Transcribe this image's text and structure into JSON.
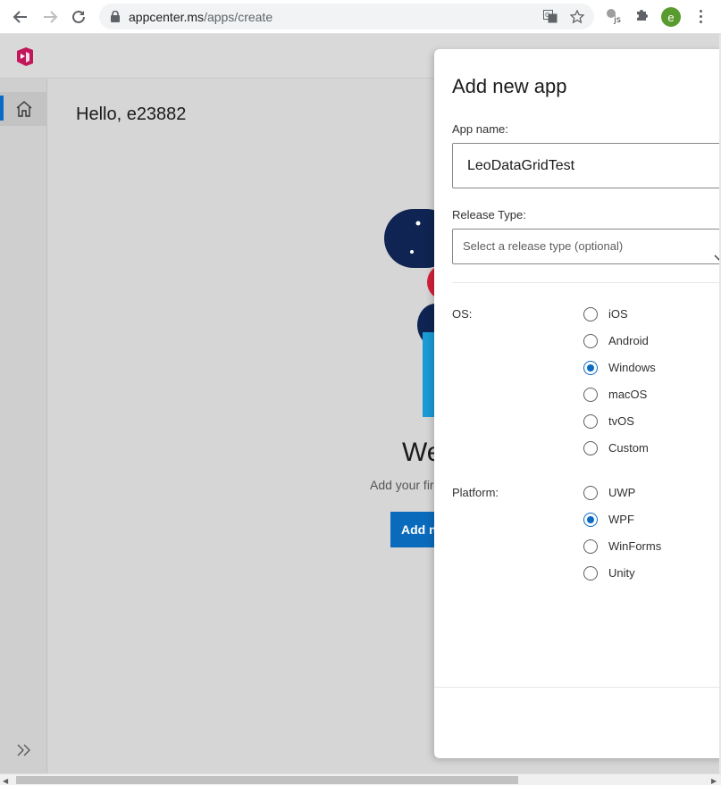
{
  "browser": {
    "url_host": "appcenter.ms",
    "url_path": "/apps/create",
    "profile_initial": "e"
  },
  "app": {
    "greeting": "Hello, e23882",
    "welcome_title": "We",
    "welcome_sub": "Add your fir",
    "add_button_label": "Add n"
  },
  "panel": {
    "title": "Add new app",
    "app_name_label": "App name:",
    "app_name_value": "LeoDataGridTest",
    "release_type_label": "Release Type:",
    "release_type_placeholder": "Select a release type (optional)",
    "os_label": "OS:",
    "os_options": [
      "iOS",
      "Android",
      "Windows",
      "macOS",
      "tvOS",
      "Custom"
    ],
    "os_selected": "Windows",
    "platform_label": "Platform:",
    "platform_options": [
      "UWP",
      "WPF",
      "WinForms",
      "Unity"
    ],
    "platform_selected": "WPF"
  },
  "colors": {
    "accent": "#0a6bc7",
    "brand": "#c2185b"
  }
}
